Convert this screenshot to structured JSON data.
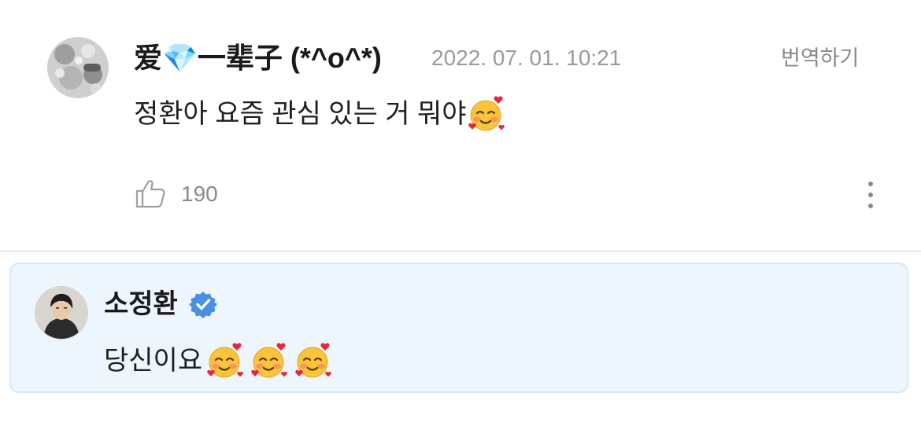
{
  "comment": {
    "username": "爱💎一辈子 (*^o^*)",
    "date": "2022. 07. 01. 10:21",
    "translate_label": "번역하기",
    "text": "정환아 요즘 관심 있는 거 뭐야",
    "emoji": "smiling-face-with-hearts",
    "like_count": "190",
    "like_icon": "thumbs-up-icon",
    "more_icon": "vertical-ellipsis-icon"
  },
  "reply": {
    "author": "소정환",
    "verified_icon": "verified-badge-icon",
    "text": "당신이요",
    "emoji_count": 3
  },
  "colors": {
    "reply_background": "#eef6fd",
    "reply_border": "#d4e8f8",
    "verified_badge": "#4a90e2",
    "muted_text": "#9a9a9a"
  }
}
